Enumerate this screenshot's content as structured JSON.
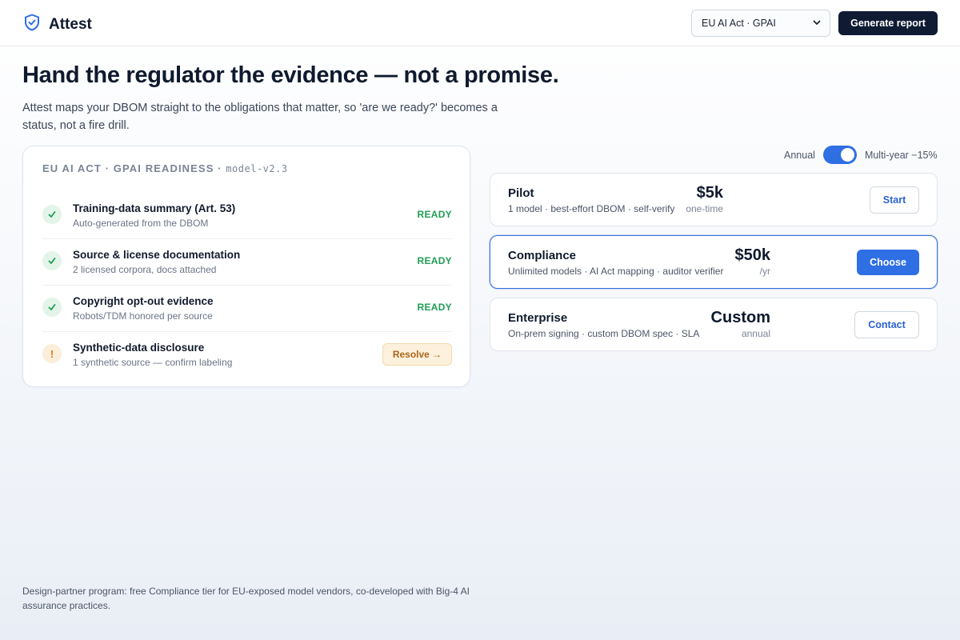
{
  "header": {
    "brand_name": "Attest",
    "framework_select_value": "EU AI Act · GPAI",
    "generate_label": "Generate report"
  },
  "hero": {
    "title": "Hand the regulator the evidence — not a promise.",
    "subtitle": "Attest maps your DBOM straight to the obligations that matter, so 'are we ready?' becomes a status, not a fire drill."
  },
  "readiness": {
    "title": "EU AI ACT · GPAI READINESS · ",
    "model": "model-v2.3",
    "items": [
      {
        "title": "Training-data summary (Art. 53)",
        "subtitle": "Auto-generated from the DBOM",
        "status": "READY"
      },
      {
        "title": "Source & license documentation",
        "subtitle": "2 licensed corpora, docs attached",
        "status": "READY"
      },
      {
        "title": "Copyright opt-out evidence",
        "subtitle": "Robots/TDM honored per source",
        "status": "READY"
      },
      {
        "title": "Synthetic-data disclosure",
        "subtitle": "1 synthetic source — confirm labeling",
        "action": "Resolve →",
        "warn_glyph": "!"
      }
    ]
  },
  "billing_toggle": {
    "left_label": "Annual",
    "right_label": "Multi-year −15%",
    "multi_year_enabled": true
  },
  "plans": [
    {
      "name": "Pilot",
      "desc": "1 model · best-effort DBOM · self-verify",
      "price": "$5k",
      "period": "one-time",
      "cta": "Start"
    },
    {
      "name": "Compliance",
      "desc": "Unlimited models · AI Act mapping · auditor verifier",
      "price": "$50k",
      "period": "/yr",
      "cta": "Choose"
    },
    {
      "name": "Enterprise",
      "desc": "On-prem signing · custom DBOM spec · SLA",
      "price": "Custom",
      "period": "annual",
      "cta": "Contact"
    }
  ],
  "footer": {
    "note": "Design-partner program: free Compliance tier for EU-exposed model vendors, co-developed with Big-4 AI assurance practices."
  },
  "colors": {
    "accent": "#2f6fe4",
    "dark": "#0f1a33",
    "ready": "#1f9d55",
    "warn": "#d97a1a"
  }
}
